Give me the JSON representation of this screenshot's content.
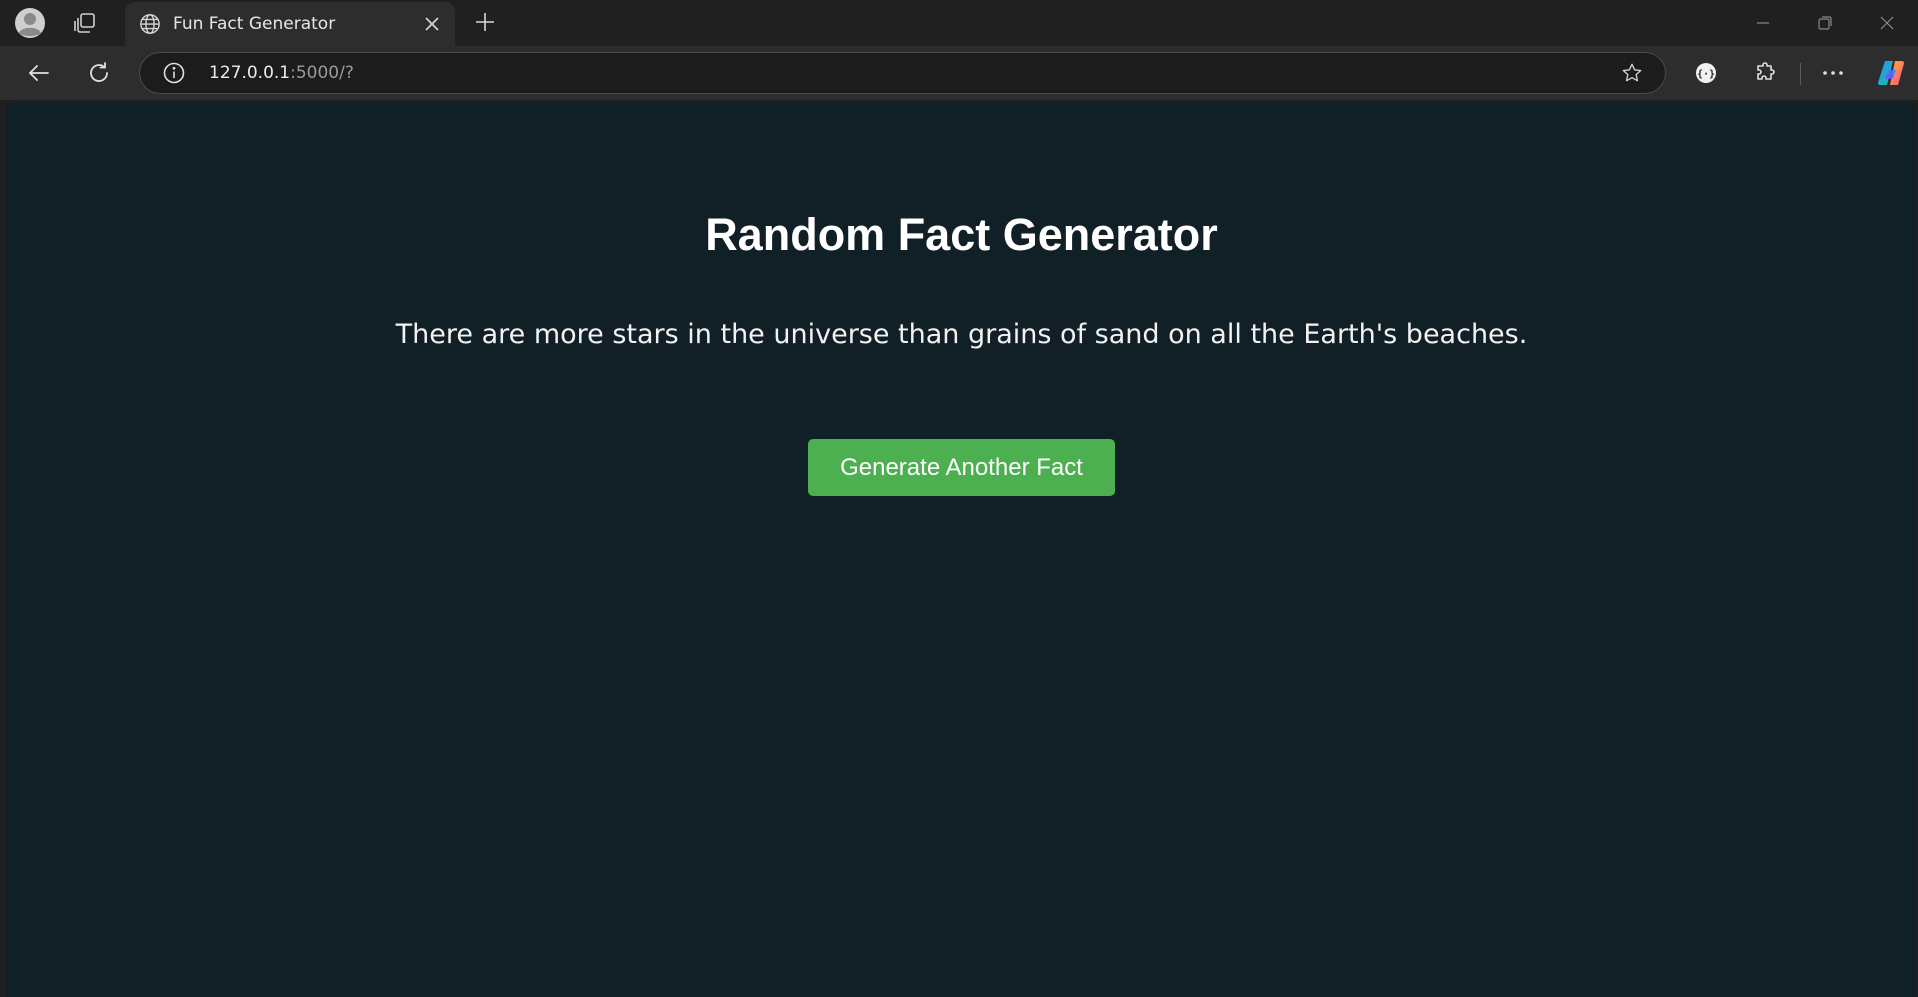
{
  "browser": {
    "tab": {
      "title": "Fun Fact Generator",
      "favicon": "globe-icon"
    },
    "address": {
      "host": "127.0.0.1",
      "rest": ":5000/?"
    },
    "icons": {
      "profile": "profile-icon",
      "workspaces": "workspaces-icon",
      "close_tab": "close-icon",
      "new_tab": "plus-icon",
      "back": "back-arrow-icon",
      "reload": "reload-icon",
      "site_info": "info-icon",
      "favorite": "star-icon",
      "extension_a": "braces-icon",
      "extension_b": "puzzle-icon",
      "more": "more-icon",
      "copilot": "copilot-icon"
    }
  },
  "page": {
    "title": "Random Fact Generator",
    "fact": "There are more stars in the universe than grains of sand on all the Earth's beaches.",
    "button_label": "Generate Another Fact"
  },
  "colors": {
    "page_background": "#111f26",
    "button": "#4caf50",
    "text": "#ffffff"
  }
}
